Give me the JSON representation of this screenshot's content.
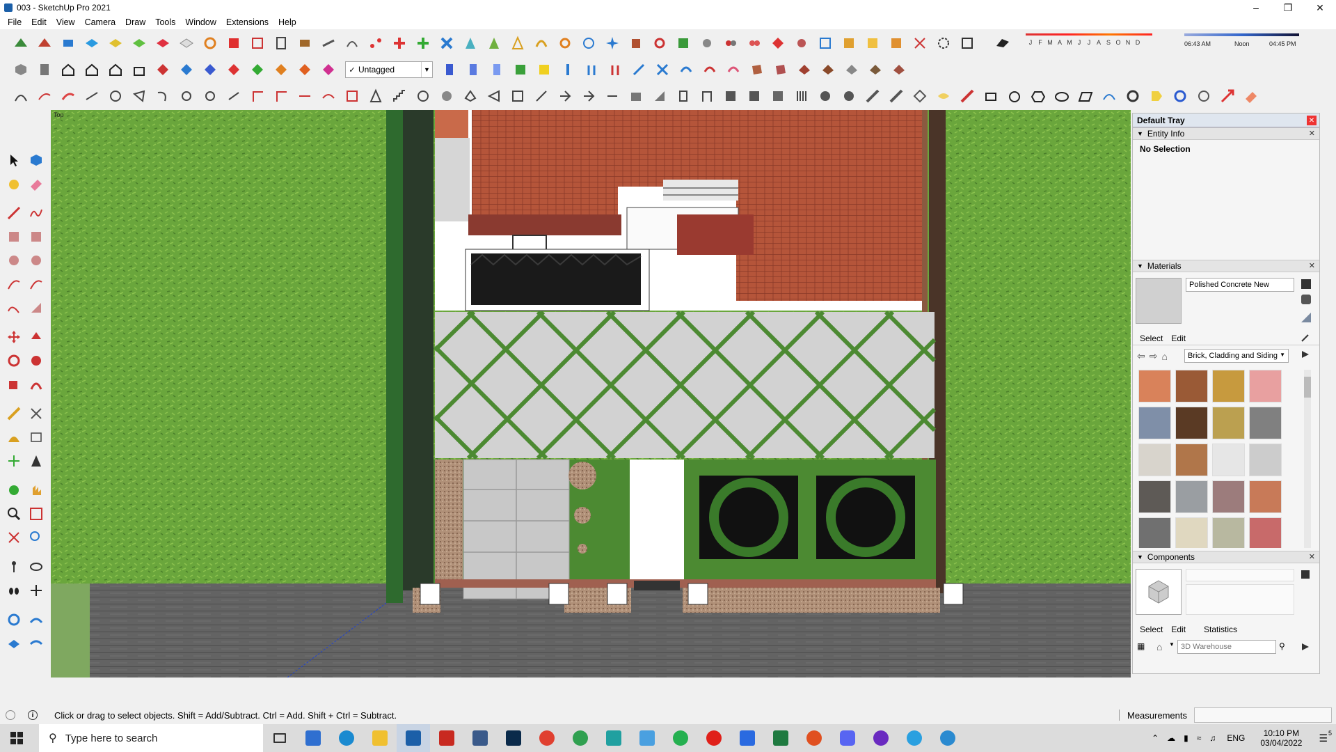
{
  "window": {
    "title": "003 - SketchUp Pro 2021"
  },
  "menu": [
    "File",
    "Edit",
    "View",
    "Camera",
    "Draw",
    "Tools",
    "Window",
    "Extensions",
    "Help"
  ],
  "toolbar": {
    "tag_selected": "Untagged"
  },
  "shadows": {
    "months": [
      "J",
      "F",
      "M",
      "A",
      "M",
      "J",
      "J",
      "A",
      "S",
      "O",
      "N",
      "D"
    ],
    "time_start": "06:43 AM",
    "time_mid": "Noon",
    "time_end": "04:45 PM"
  },
  "viewport": {
    "view_label": "Top"
  },
  "tray": {
    "title": "Default Tray",
    "entity_info": {
      "heading": "Entity Info",
      "selection": "No Selection"
    },
    "materials": {
      "heading": "Materials",
      "current_material": "Polished Concrete New",
      "tabs": [
        "Select",
        "Edit"
      ],
      "collection": "Brick, Cladding and Siding",
      "swatch_colors": [
        "#d9825a",
        "#9a5a36",
        "#c79a3e",
        "#e8a0a0",
        "#7f8fa8",
        "#5a3a24",
        "#bba050",
        "#808080",
        "#d8d4cc",
        "#b0764a",
        "#e6e6e6",
        "#cccccc",
        "#5e5a56",
        "#9a9ea2",
        "#9c7c7c",
        "#c87a58",
        "#707070",
        "#e0d8c0",
        "#b8b8a0",
        "#c86a6a"
      ]
    },
    "components": {
      "heading": "Components",
      "tabs": [
        "Select",
        "Edit",
        "Statistics"
      ],
      "search_placeholder": "3D Warehouse"
    }
  },
  "status": {
    "hint": "Click or drag to select objects. Shift = Add/Subtract. Ctrl = Add. Shift + Ctrl = Subtract.",
    "measurements_label": "Measurements"
  },
  "taskbar": {
    "search_placeholder": "Type here to search",
    "language": "ENG",
    "time": "10:10 PM",
    "date": "03/04/2022",
    "notification_count": "5"
  },
  "colors": {
    "grass": "#6aa040",
    "roof": "#b8563a",
    "paving": "#d2d2d2",
    "road": "#5f5f5f",
    "accent": "#1b5fa8"
  }
}
